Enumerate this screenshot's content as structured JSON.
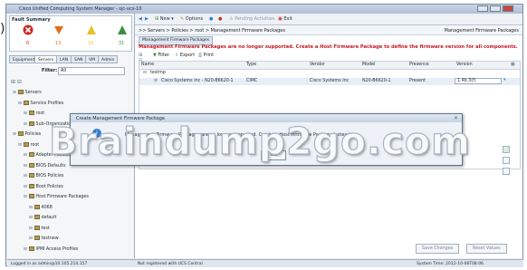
{
  "stray_char": ")",
  "window": {
    "title": "Cisco Unified Computing System Manager - sjc-ucs-10"
  },
  "fault_summary": {
    "title": "Fault Summary",
    "counts": [
      {
        "icon": "critical-icon",
        "value": "6",
        "color": "#c72b22"
      },
      {
        "icon": "major-icon",
        "value": "13",
        "color": "#e36c1b"
      },
      {
        "icon": "minor-icon",
        "value": "10",
        "color": "#e6c02a"
      },
      {
        "icon": "warning-icon",
        "value": "31",
        "color": "#3a8d3a"
      }
    ]
  },
  "nav_tabs": [
    "Equipment",
    "Servers",
    "LAN",
    "SAN",
    "VM",
    "Admin"
  ],
  "filter": {
    "label": "Filter:",
    "value": "All"
  },
  "tree": [
    {
      "label": "Servers",
      "indent": 0
    },
    {
      "label": "Service Profiles",
      "indent": 1
    },
    {
      "label": "root",
      "indent": 2
    },
    {
      "label": "Sub-Organizations",
      "indent": 2
    },
    {
      "label": "Policies",
      "indent": 0
    },
    {
      "label": "root",
      "indent": 1
    },
    {
      "label": "Adapter Policies",
      "indent": 2
    },
    {
      "label": "BIOS Defaults",
      "indent": 2
    },
    {
      "label": "BIOS Policies",
      "indent": 2
    },
    {
      "label": "Boot Policies",
      "indent": 2
    },
    {
      "label": "Host Firmware Packages",
      "indent": 2
    },
    {
      "label": "4068",
      "indent": 3
    },
    {
      "label": "default",
      "indent": 3
    },
    {
      "label": "test",
      "indent": 3
    },
    {
      "label": "testnew",
      "indent": 3
    },
    {
      "label": "IPMI Access Profiles",
      "indent": 2
    }
  ],
  "toolbar": {
    "new": "New",
    "options": "Options",
    "pending": "Pending Activities",
    "exit": "Exit"
  },
  "breadcrumb": {
    "path": ">> Servers > Policies > root > Management Firmware Packages",
    "right": "Management Firmware Packages"
  },
  "subtab": "Management Firmware Packages",
  "warning": "Management Firmware Packages are no longer supported. Create a Host Firmware Package to define the firmware version for all components.",
  "inner_toolbar": {
    "filter": "Filter",
    "export": "Export",
    "print": "Print"
  },
  "table": {
    "columns": [
      "Name",
      "Type",
      "Vendor",
      "Model",
      "Presence",
      "Version"
    ],
    "rows": [
      {
        "name": "testmp",
        "type": "",
        "vendor": "",
        "model": "",
        "presence": "",
        "version": ""
      },
      {
        "name": "Cisco Systems Inc - N20-B6620-1",
        "type": "CIMC",
        "vendor": "Cisco Systems Inc",
        "model": "N20-B6620-1",
        "presence": "Present",
        "version": "1.4b.3(f)"
      }
    ]
  },
  "buttons": {
    "save": "Save Changes",
    "reset": "Reset Values"
  },
  "status": {
    "login": "Logged in as admin@10.105.214.157",
    "central": "Not registered with UCS Central",
    "time": "System Time: 2012-10-06T08:06"
  },
  "dialog": {
    "title": "Create Management Firmware Package",
    "message": "Management Firmware Packages are no longer supported. Create a Host Firmware Package instead.",
    "ok": "OK"
  },
  "watermark": "Braindump2go.com"
}
